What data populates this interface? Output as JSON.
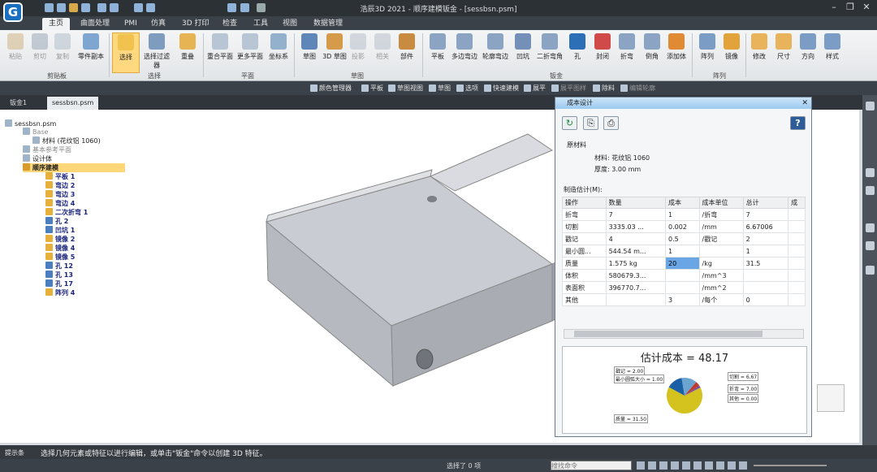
{
  "app": {
    "title": "浩辰3D 2021 - 顺序建模钣金 - [sessbsn.psm]"
  },
  "window_controls": {
    "minimize": "–",
    "maximize": "❐",
    "close": "✕"
  },
  "menu": {
    "tabs": [
      "主页",
      "曲面处理",
      "PMI",
      "仿真",
      "3D 打印",
      "检查",
      "工具",
      "视图",
      "数据管理"
    ]
  },
  "ribbon": {
    "clipboard": {
      "paste": "粘贴",
      "cut": "剪切",
      "copy": "复制",
      "part_copy": "零件副本",
      "group": "剪贴板"
    },
    "select": {
      "select": "选择",
      "select_filter": "选择过滤器",
      "overlap": "重叠",
      "group": "选择"
    },
    "plane": {
      "coincident": "重合平面",
      "more_planes": "更多平面",
      "coord": "坐标系",
      "group": "平面"
    },
    "sketch": {
      "sketch": "草图",
      "sketch3d": "3D\n草图",
      "project": "投影",
      "relation": "相关",
      "component": "部件",
      "group": "草图"
    },
    "sheetmetal": {
      "flat": "平板",
      "contour_flange": "多边弯边",
      "profile_flange": "轮廓弯边",
      "dimple": "凹坑",
      "secondary_bend": "二折弯角",
      "hole": "孔",
      "close": "封闭",
      "bend": "折弯",
      "corner": "倒角",
      "add_body": "添加体",
      "group": "钣金"
    },
    "pattern": {
      "array": "阵列",
      "mirror": "镜像",
      "group": "阵列"
    },
    "modify": "修改",
    "size": "尺寸",
    "direction": "方向",
    "style": "样式"
  },
  "toolbar2": [
    "颜色管理器",
    "平板",
    "草图视图",
    "草图",
    "选项",
    "快速建模",
    "展平",
    "展平图样",
    "除料",
    "编辑轮廓"
  ],
  "doc_tabs": [
    "钣金1",
    "sessbsn.psm"
  ],
  "tree": {
    "root": "sessbsn.psm",
    "base": "Base",
    "material": "材料 (花纹铝 1060)",
    "ref_planes": "基本参考平面",
    "design_body": "设计体",
    "seq_model": "顺序建模",
    "features": [
      "平板 1",
      "弯边 2",
      "弯边 3",
      "弯边 4",
      "二次折弯 1",
      "孔 2",
      "凹坑 1",
      "镜像 2",
      "镜像 4",
      "镜像 5",
      "孔 12",
      "孔 13",
      "孔 17",
      "阵列 4"
    ]
  },
  "panel": {
    "title": "成本设计",
    "help": "?",
    "raw_material_label": "原材料",
    "material": "材料: 花纹铝 1060",
    "thickness": "厚度: 3.00 mm",
    "estimate_label": "制造估计(M):",
    "columns": [
      "操作",
      "数量",
      "成本",
      "成本单位",
      "总计",
      "成"
    ],
    "rows": [
      [
        "折弯",
        "7",
        "1",
        "/折弯",
        "7"
      ],
      [
        "切割",
        "3335.03 ...",
        "0.002",
        "/mm",
        "6.67006"
      ],
      [
        "戳记",
        "4",
        "0.5",
        "/戳记",
        "2"
      ],
      [
        "最小圆...",
        "544.54 m...",
        "1",
        "",
        "1"
      ],
      [
        "质量",
        "1.575 kg",
        "20",
        "/kg",
        "31.5"
      ],
      [
        "体积",
        "580679.3...",
        "",
        "/mm^3",
        ""
      ],
      [
        "表面积",
        "396770.7...",
        "",
        "/mm^2",
        ""
      ],
      [
        "其他",
        "",
        "3",
        "/每个",
        "0"
      ]
    ],
    "estimate_title": "估计成本 = 48.17",
    "pie_labels": {
      "stamp": "戳记 = 2.00",
      "min_circle": "最小圆弧大小 = 1.00",
      "cut": "切割 = 6.67",
      "bend": "折弯 = 7.00",
      "other": "其他 = 0.00",
      "mass": "质量 = 31.50"
    }
  },
  "chart_data": {
    "type": "pie",
    "title": "估计成本 = 48.17",
    "categories": [
      "质量",
      "折弯",
      "切割",
      "戳记",
      "最小圆弧大小",
      "其他"
    ],
    "values": [
      31.5,
      7.0,
      6.67,
      2.0,
      1.0,
      0.0
    ],
    "colors": [
      "#d4c21e",
      "#1b5fa6",
      "#6aa4cf",
      "#c0392b",
      "#7e4b9e",
      "#2a8c4a"
    ]
  },
  "status": {
    "prompt_label": "提示条",
    "prompt_text": "选择几何元素或特征以进行编辑，或单击\"钣金\"命令以创建 3D 特征。",
    "selection": "选择了 0 项",
    "search_placeholder": "搜找命令"
  }
}
